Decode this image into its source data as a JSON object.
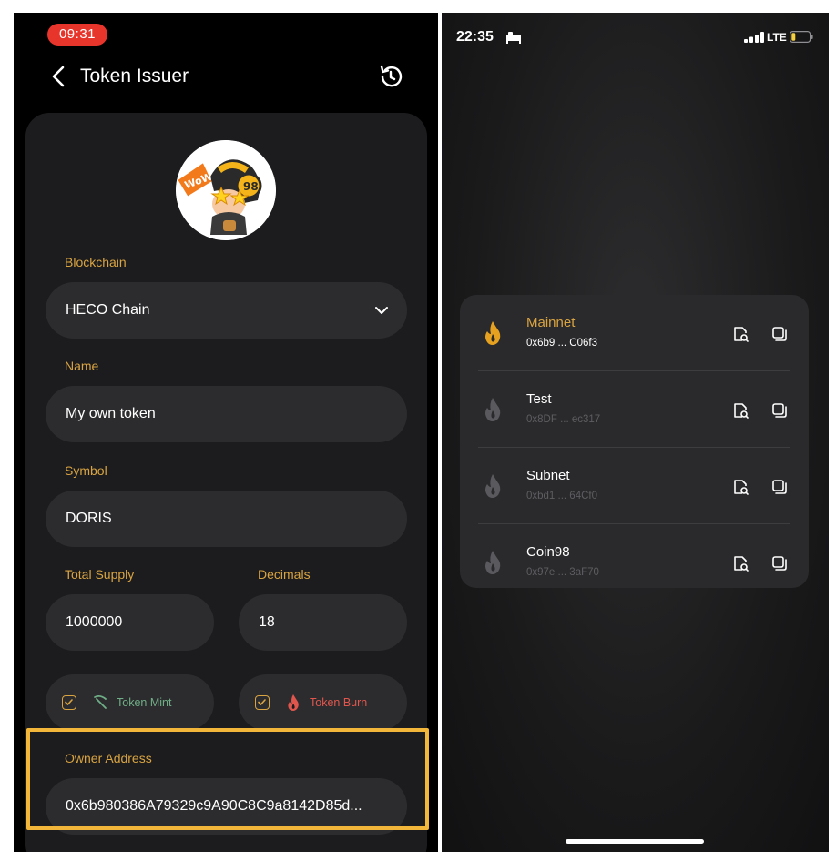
{
  "left_screen": {
    "status_time": "09:31",
    "header": {
      "title": "Token Issuer"
    },
    "form": {
      "blockchain_label": "Blockchain",
      "blockchain_value": "HECO Chain",
      "name_label": "Name",
      "name_value": "My own token",
      "symbol_label": "Symbol",
      "symbol_value": "DORIS",
      "total_supply_label": "Total Supply",
      "total_supply_value": "1000000",
      "decimals_label": "Decimals",
      "decimals_value": "18",
      "mint_label": "Token Mint",
      "mint_checked": true,
      "burn_label": "Token Burn",
      "burn_checked": true,
      "owner_label": "Owner Address",
      "owner_value": "0x6b980386A79329c9A90C8C9a8142D85d..."
    },
    "avatar_text": "WoW"
  },
  "right_screen": {
    "status_time": "22:35",
    "network_type": "LTE",
    "networks": [
      {
        "name": "Mainnet",
        "address": "0x6b9 ... C06f3",
        "active": true
      },
      {
        "name": "Test",
        "address": "0x8DF ... ec317",
        "active": false
      },
      {
        "name": "Subnet",
        "address": "0xbd1 ... 64Cf0",
        "active": false
      },
      {
        "name": "Coin98",
        "address": "0x97e ... 3aF70",
        "active": false
      }
    ]
  },
  "colors": {
    "accent_gold": "#d9a441",
    "highlight_border": "#f2b63a",
    "time_pill": "#e8352c",
    "mint_green": "#6fae86",
    "burn_red": "#e0564d"
  },
  "icons": {
    "back": "chevron-left-icon",
    "history": "history-icon",
    "dropdown": "chevron-down-icon",
    "mint": "pickaxe-icon",
    "burn": "flame-icon",
    "network": "flame-icon",
    "doc": "document-search-icon",
    "copy": "copy-icon"
  }
}
